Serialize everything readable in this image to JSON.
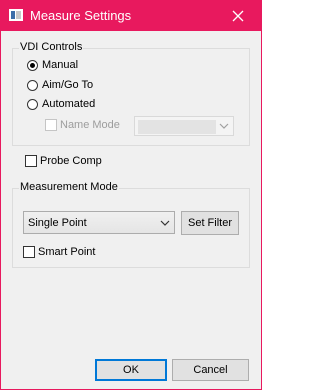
{
  "window": {
    "title": "Measure Settings",
    "accent": "#e8195e"
  },
  "vdi_controls": {
    "label": "VDI Controls",
    "options": [
      {
        "label": "Manual",
        "selected": true
      },
      {
        "label": "Aim/Go To",
        "selected": false
      },
      {
        "label": "Automated",
        "selected": false
      }
    ],
    "name_mode": {
      "label": "Name Mode",
      "checked": false,
      "enabled": false,
      "selected_value": ""
    }
  },
  "probe_comp": {
    "label": "Probe Comp",
    "checked": false
  },
  "measurement_mode": {
    "label": "Measurement Mode",
    "selected_value": "Single Point",
    "set_filter_label": "Set Filter",
    "smart_point": {
      "label": "Smart Point",
      "checked": false
    }
  },
  "footer": {
    "ok_label": "OK",
    "cancel_label": "Cancel"
  }
}
